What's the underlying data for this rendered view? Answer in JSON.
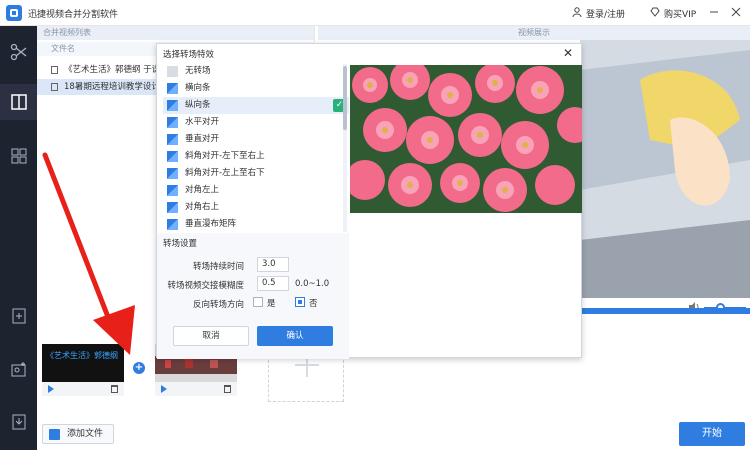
{
  "app": {
    "title": "迅捷视频合并分割软件",
    "login_label": "登录/注册",
    "vip_label": "购买VIP"
  },
  "list_panel": {
    "header": "合并视频列表",
    "column_name": "文件名",
    "files": [
      "《艺术生活》郭德纲 于谦",
      "18暑期远程培训教学设计"
    ]
  },
  "preview_panel": {
    "header": "视频展示"
  },
  "timeline": {
    "clip1_label": "《艺术生活》郭德纲",
    "add_file_label": "添加文件",
    "start_label": "开始"
  },
  "dialog": {
    "title": "选择转场特效",
    "transitions": [
      "无转场",
      "横向条",
      "纵向条",
      "水平对开",
      "垂直对开",
      "斜角对开-左下至右上",
      "斜角对开-左上至右下",
      "对角左上",
      "对角右上",
      "垂直漫布矩阵"
    ],
    "selected_index": 2,
    "settings_title": "转场设置",
    "duration_label": "转场持续时间",
    "duration_value": "3.0",
    "blur_label": "转场视频交接模糊度",
    "blur_value": "0.5",
    "blur_hint": "0.0~1.0",
    "reverse_label": "反向转场方向",
    "yes_label": "是",
    "no_label": "否",
    "reverse_value": "否",
    "cancel_label": "取消",
    "ok_label": "确认"
  },
  "colors": {
    "accent": "#2f7de1",
    "sidebar": "#1e2330",
    "check": "#29b07c",
    "arrow": "#e8201a"
  }
}
